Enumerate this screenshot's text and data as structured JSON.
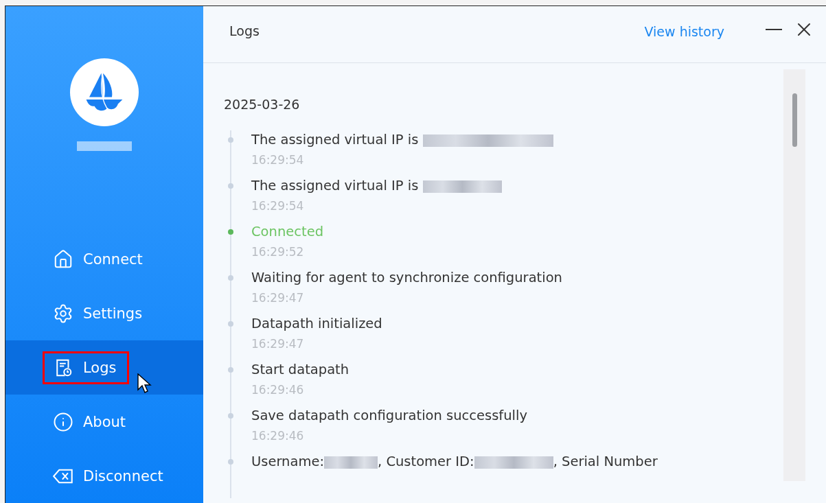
{
  "sidebar": {
    "nav": [
      {
        "label": "Connect",
        "selected": false,
        "annotated": false
      },
      {
        "label": "Settings",
        "selected": false,
        "annotated": false
      },
      {
        "label": "Logs",
        "selected": true,
        "annotated": true
      },
      {
        "label": "About",
        "selected": false,
        "annotated": false
      },
      {
        "label": "Disconnect",
        "selected": false,
        "annotated": false
      }
    ]
  },
  "header": {
    "title": "Logs",
    "link": "View history"
  },
  "log": {
    "date": "2025-03-26",
    "entries": [
      {
        "kind": "event",
        "parts": [
          {
            "kind": "text",
            "text": "The assigned virtual IP is "
          },
          {
            "kind": "redacted"
          }
        ],
        "time": "16:29:54"
      },
      {
        "kind": "event",
        "parts": [
          {
            "kind": "text",
            "text": "The assigned virtual IP is "
          },
          {
            "kind": "redacted"
          }
        ],
        "time": "16:29:54"
      },
      {
        "kind": "success",
        "parts": [
          {
            "kind": "text",
            "text": "Connected"
          }
        ],
        "time": "16:29:52"
      },
      {
        "kind": "event",
        "parts": [
          {
            "kind": "text",
            "text": "Waiting for agent to synchronize configuration"
          }
        ],
        "time": "16:29:47"
      },
      {
        "kind": "event",
        "parts": [
          {
            "kind": "text",
            "text": "Datapath initialized"
          }
        ],
        "time": "16:29:47"
      },
      {
        "kind": "event",
        "parts": [
          {
            "kind": "text",
            "text": "Start datapath"
          }
        ],
        "time": "16:29:46"
      },
      {
        "kind": "event",
        "parts": [
          {
            "kind": "text",
            "text": "Save datapath configuration successfully"
          }
        ],
        "time": "16:29:46"
      },
      {
        "kind": "event",
        "parts": [
          {
            "kind": "text",
            "text": "Username:"
          },
          {
            "kind": "redacted"
          },
          {
            "kind": "text",
            "text": ", Customer ID:"
          },
          {
            "kind": "redacted"
          },
          {
            "kind": "text",
            "text": ", Serial Number"
          }
        ]
      }
    ]
  }
}
